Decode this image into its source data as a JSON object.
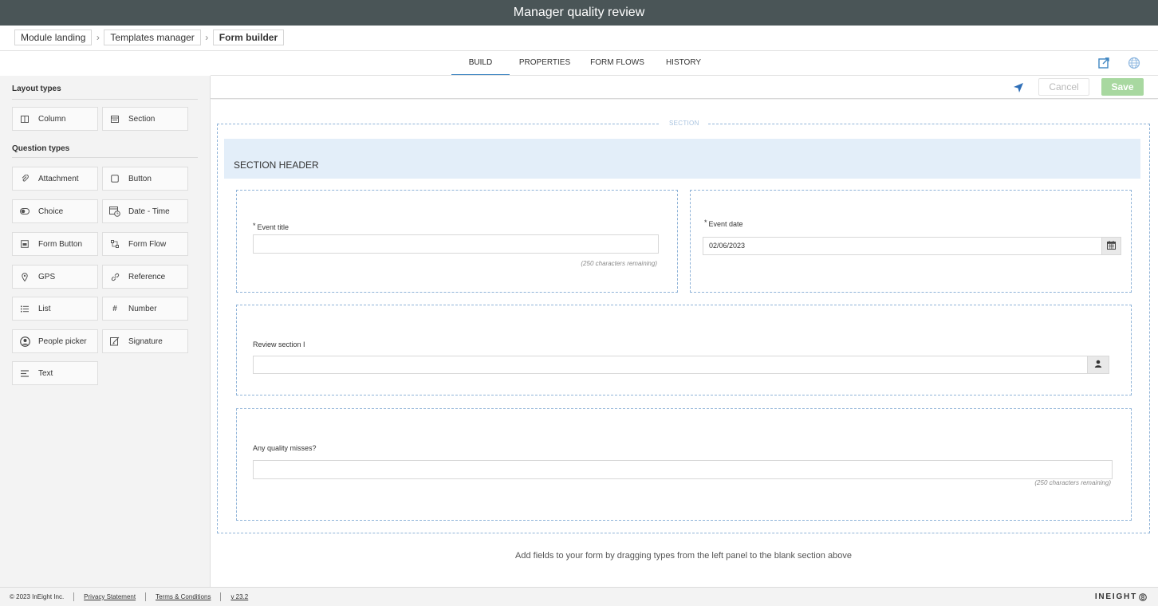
{
  "app": {
    "title": "Manager quality review"
  },
  "breadcrumb": [
    "Module landing",
    "Templates manager",
    "Form builder"
  ],
  "tabs": [
    "BUILD",
    "PROPERTIES",
    "FORM FLOWS",
    "HISTORY"
  ],
  "active_tab": "BUILD",
  "actions": {
    "cancel_label": "Cancel",
    "save_label": "Save"
  },
  "sidebar": {
    "layout_heading": "Layout types",
    "layout_items": [
      {
        "label": "Column",
        "icon": "column-icon"
      },
      {
        "label": "Section",
        "icon": "section-icon"
      }
    ],
    "question_heading": "Question types",
    "question_items": [
      {
        "label": "Attachment",
        "icon": "paperclip-icon"
      },
      {
        "label": "Button",
        "icon": "checkbox-icon"
      },
      {
        "label": "Choice",
        "icon": "toggle-icon"
      },
      {
        "label": "Date - Time",
        "icon": "calendar-clock-icon"
      },
      {
        "label": "Form Button",
        "icon": "form-button-icon"
      },
      {
        "label": "Form Flow",
        "icon": "flow-icon"
      },
      {
        "label": "GPS",
        "icon": "location-pin-icon"
      },
      {
        "label": "Reference",
        "icon": "link-icon"
      },
      {
        "label": "List",
        "icon": "list-icon"
      },
      {
        "label": "Number",
        "icon": "hash-icon"
      },
      {
        "label": "People picker",
        "icon": "person-circle-icon"
      },
      {
        "label": "Signature",
        "icon": "pen-icon"
      },
      {
        "label": "Text",
        "icon": "text-lines-icon"
      }
    ]
  },
  "form": {
    "section_tag": "SECTION",
    "section_header": "SECTION HEADER",
    "event_title": {
      "label": "Event title",
      "required": "*",
      "value": "",
      "note": "(250 characters remaining)"
    },
    "event_date": {
      "label": "Event date",
      "required": "*",
      "value": "02/06/2023"
    },
    "review_section": {
      "label": "Review section I",
      "value": ""
    },
    "quality_misses": {
      "label": "Any quality misses?",
      "value": "",
      "note": "(250 characters remaining)"
    },
    "hint": "Add fields to your form by dragging types from the left panel to the blank section above"
  },
  "footer": {
    "copyright": "© 2023 InEight Inc.",
    "privacy": "Privacy Statement",
    "terms": "Terms & Conditions",
    "version": "v 23.2",
    "brand": "INEIGHT"
  },
  "colors": {
    "titlebar": "#4a5557",
    "accent": "#3f86c2",
    "save": "#a8d8a0",
    "section_bg": "#e3eef9",
    "dashed_border": "#8fb3d8"
  }
}
